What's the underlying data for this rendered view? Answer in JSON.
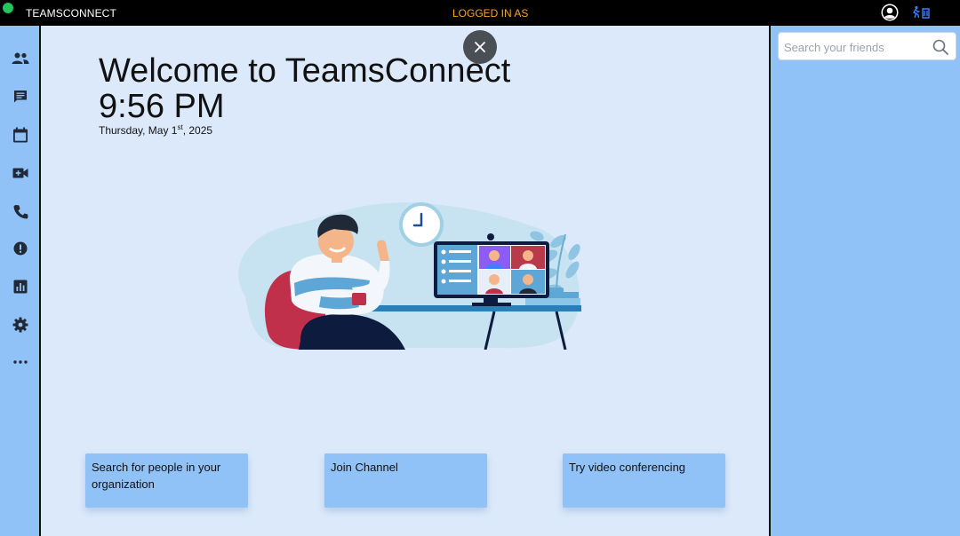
{
  "topbar": {
    "brand": "TEAMSCONNECT",
    "logged_in_label": "LOGGED IN AS",
    "status_color": "#22c55e",
    "logged_color": "#f5a623",
    "icons": [
      "user-avatar-icon",
      "logout-icon"
    ]
  },
  "sidebar": {
    "items": [
      {
        "icon": "people-icon",
        "name": "Teams"
      },
      {
        "icon": "chat-icon",
        "name": "Chat"
      },
      {
        "icon": "calendar-icon",
        "name": "Calendar"
      },
      {
        "icon": "video-call-icon",
        "name": "Meetings"
      },
      {
        "icon": "phone-icon",
        "name": "Calls"
      },
      {
        "icon": "alert-icon",
        "name": "Activity"
      },
      {
        "icon": "analytics-icon",
        "name": "Analytics"
      },
      {
        "icon": "settings-icon",
        "name": "Settings"
      },
      {
        "icon": "more-icon",
        "name": "More"
      }
    ]
  },
  "main": {
    "welcome": "Welcome to TeamsConnect",
    "time": "9:56 PM",
    "date_prefix": "Thursday, May 1",
    "date_suffix": "st",
    "date_year": ", 2025",
    "cards": [
      {
        "label": "Search for people in your organization"
      },
      {
        "label": "Join Channel"
      },
      {
        "label": "Try video conferencing"
      }
    ]
  },
  "right_panel": {
    "search_placeholder": "Search your friends"
  }
}
